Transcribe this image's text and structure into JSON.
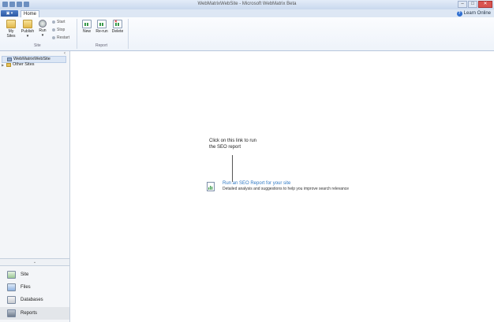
{
  "window": {
    "title": "WebMatrixWebSite - Microsoft WebMatrix Beta",
    "minimize": "–",
    "maximize": "□",
    "close": "✕"
  },
  "tabs": {
    "app_menu": "▣ ▾",
    "home": "Home"
  },
  "help": {
    "label": "Learn Online",
    "icon": "?"
  },
  "ribbon": {
    "site_group": {
      "label": "Site",
      "my_sites": [
        "My",
        "Sites"
      ],
      "publish": [
        "Publish",
        "▾"
      ],
      "run": [
        "Run",
        "▾"
      ],
      "start": "Start",
      "stop": "Stop",
      "restart": "Restart"
    },
    "report_group": {
      "label": "Report",
      "new": "New",
      "rerun": "Re-run",
      "delete": "Delete"
    }
  },
  "sidebar": {
    "collapse": "‹",
    "tree": [
      {
        "label": "WebMatrixWebSite",
        "expander": ""
      },
      {
        "label": "Other Sites",
        "expander": "▶"
      }
    ],
    "expander": "⌄",
    "nav": [
      {
        "label": "Site"
      },
      {
        "label": "Files"
      },
      {
        "label": "Databases"
      },
      {
        "label": "Reports"
      }
    ]
  },
  "main": {
    "callout": [
      "Click on this link to run",
      "the SEO report"
    ],
    "link": "Run an SEO Report for your site",
    "description": "Detailed analysis and suggestions to help you improve search relevance"
  },
  "colors": {
    "accent": "#2f79c4",
    "ribbon_border": "#b7c6db"
  }
}
